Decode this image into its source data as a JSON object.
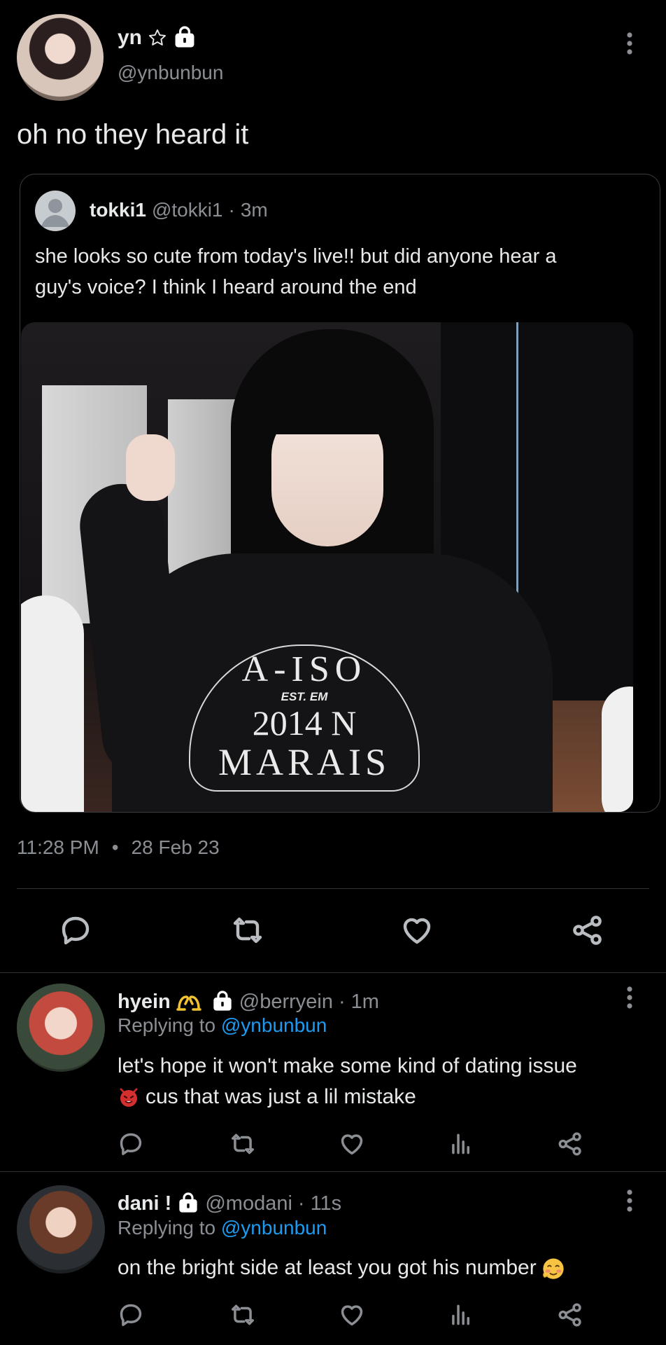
{
  "main_tweet": {
    "display_name": "yn",
    "handle": "@ynbunbun",
    "text": "oh no they heard it",
    "timestamp_time": "11:28 PM",
    "timestamp_sep": "•",
    "timestamp_date": "28 Feb 23"
  },
  "quoted_tweet": {
    "display_name": "tokki1",
    "handle": "@tokki1",
    "sep": "·",
    "age": "3m",
    "text_line1": "she looks so cute from today's live!! but did anyone hear a",
    "text_line2": "guy's voice? I think I heard around the end",
    "shirt_text": {
      "top": "A-ISO",
      "est": "EST. EM",
      "year": "2014 N",
      "bottom": "MARAIS"
    }
  },
  "replies": [
    {
      "display_name": "hyein",
      "handle": "@berryein",
      "sep": "·",
      "age": "1m",
      "replying_prefix": "Replying to",
      "replying_handle": "@ynbunbun",
      "text_line1": "let's hope it won't make some kind of dating issue",
      "text_line2": "cus that was just a lil mistake"
    },
    {
      "display_name": "dani !",
      "handle": "@modani",
      "sep": "·",
      "age": "11s",
      "replying_prefix": "Replying to",
      "replying_handle": "@ynbunbun",
      "text_line1": "on the bright side at least you got his number"
    }
  ],
  "icons": [
    "star-outline-icon",
    "lock-icon",
    "more-vertical-icon",
    "reply-icon",
    "retweet-icon",
    "like-icon",
    "share-icon",
    "analytics-icon",
    "heart-hands-emoji",
    "devil-emoji",
    "blushing-emoji",
    "default-avatar-icon"
  ],
  "colors": {
    "background": "#000000",
    "text": "#e7e9ea",
    "muted": "#8b8f94",
    "link": "#1d9bf0",
    "divider": "#2f3336"
  }
}
